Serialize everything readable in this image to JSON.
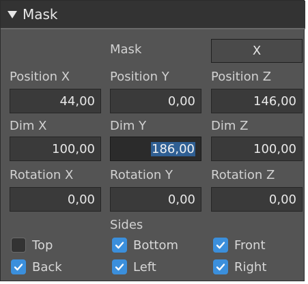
{
  "section": {
    "title": "Mask",
    "expanded": true
  },
  "mask": {
    "label": "Mask",
    "button_label": "X"
  },
  "position": {
    "x_label": "Position X",
    "y_label": "Position Y",
    "z_label": "Position Z",
    "x": "44,00",
    "y": "0,00",
    "z": "146,00"
  },
  "dim": {
    "x_label": "Dim X",
    "y_label": "Dim Y",
    "z_label": "Dim Z",
    "x": "100,00",
    "y": "186,00",
    "z": "100,00"
  },
  "rotation": {
    "x_label": "Rotation X",
    "y_label": "Rotation Y",
    "z_label": "Rotation Z",
    "x": "0,00",
    "y": "0,00",
    "z": "0,00"
  },
  "sides": {
    "label": "Sides",
    "top": {
      "label": "Top",
      "checked": false
    },
    "bottom": {
      "label": "Bottom",
      "checked": true
    },
    "front": {
      "label": "Front",
      "checked": true
    },
    "back": {
      "label": "Back",
      "checked": true
    },
    "left": {
      "label": "Left",
      "checked": true
    },
    "right": {
      "label": "Right",
      "checked": true
    }
  },
  "colors": {
    "panel_bg": "#545454",
    "header_bg": "#333333",
    "field_bg": "#3a3a3a",
    "checkbox_on": "#3b8fdc",
    "selection": "#2f5f93"
  },
  "icons": {
    "collapse": "triangle-down-icon",
    "check": "checkmark-icon"
  }
}
